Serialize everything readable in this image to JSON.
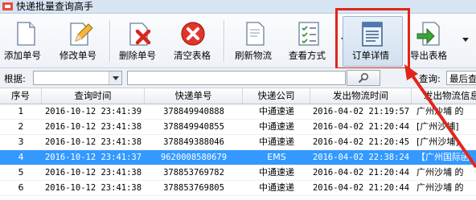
{
  "window": {
    "title": "快递批量查询高手"
  },
  "toolbar": {
    "buttons": [
      {
        "label": "添加单号",
        "icon": "document-add-icon"
      },
      {
        "label": "修改单号",
        "icon": "document-edit-icon"
      },
      {
        "label": "删除单号",
        "icon": "document-delete-icon"
      },
      {
        "label": "清空表格",
        "icon": "clear-icon"
      },
      {
        "label": "刷新物流",
        "icon": "refresh-document-icon"
      },
      {
        "label": "查看方式",
        "icon": "checklist-icon"
      },
      {
        "label": "订单详情",
        "icon": "order-detail-icon"
      },
      {
        "label": "导出表格",
        "icon": "export-icon"
      }
    ]
  },
  "filter": {
    "root_label": "根据:",
    "root_value": "",
    "search_value": "",
    "query_label": "查询:",
    "query_value": "最后查"
  },
  "table": {
    "columns": [
      "序号",
      "查询时间",
      "快递单号",
      "快递公司",
      "发出物流时间",
      "发出物流信息"
    ],
    "rows": [
      [
        "1",
        "2016-10-12 23:41:39",
        "378849940888",
        "中通速递",
        "2016-04-02 21:19:57",
        "广州沙埔 的"
      ],
      [
        "2",
        "2016-10-12 23:41:38",
        "378849940855",
        "中通速递",
        "2016-04-02 21:20:44",
        "[广州沙埔]"
      ],
      [
        "3",
        "2016-10-12 23:41:38",
        "378849388046",
        "中通速递",
        "2016-04-02 21:20:45",
        "[广州沙埔]"
      ],
      [
        "4",
        "2016-10-12 23:41:37",
        "9620008580679",
        "EMS",
        "2016-04-02 22:38:24",
        "【广州国际函"
      ],
      [
        "5",
        "2016-10-12 23:41:38",
        "378853769782",
        "中通速递",
        "2016-04-02 21:20:44",
        "广州沙埔 的"
      ],
      [
        "6",
        "2016-10-12 23:41:38",
        "378853769805",
        "中通速递",
        "2016-04-02 21:20:44",
        "广州沙埔 的"
      ]
    ],
    "selected_index": 3
  },
  "colors": {
    "selection": "#3399ff",
    "highlight_box": "#e0261b",
    "arrow": "#e0261b"
  }
}
